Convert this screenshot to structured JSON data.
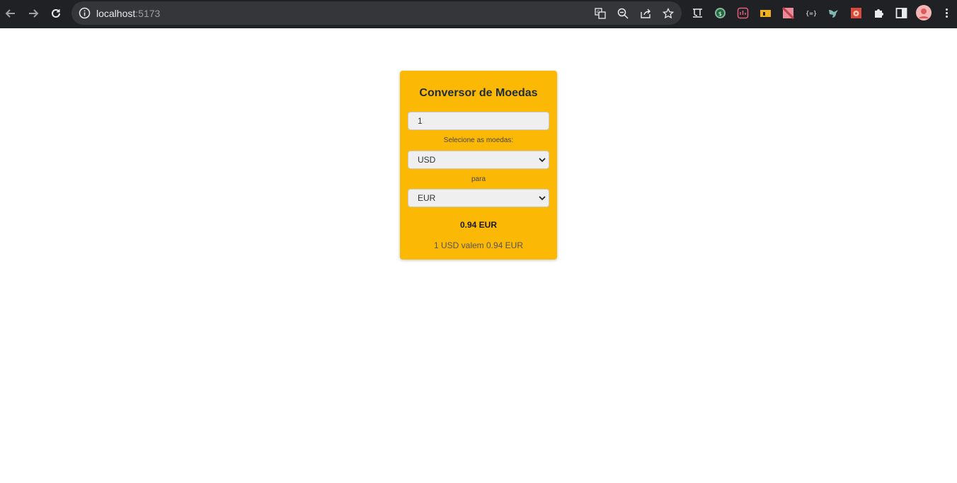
{
  "browser": {
    "url_host": "localhost",
    "url_port": ":5173"
  },
  "converter": {
    "title": "Conversor de Moedas",
    "amount_value": "1",
    "select_label": "Selecione as moedas:",
    "from_currency": "USD",
    "to_label": "para",
    "to_currency": "EUR",
    "result": "0.94 EUR",
    "rate_text": "1 USD valem 0.94 EUR"
  },
  "colors": {
    "card_background": "#fbb805",
    "chrome_background": "#202124"
  }
}
